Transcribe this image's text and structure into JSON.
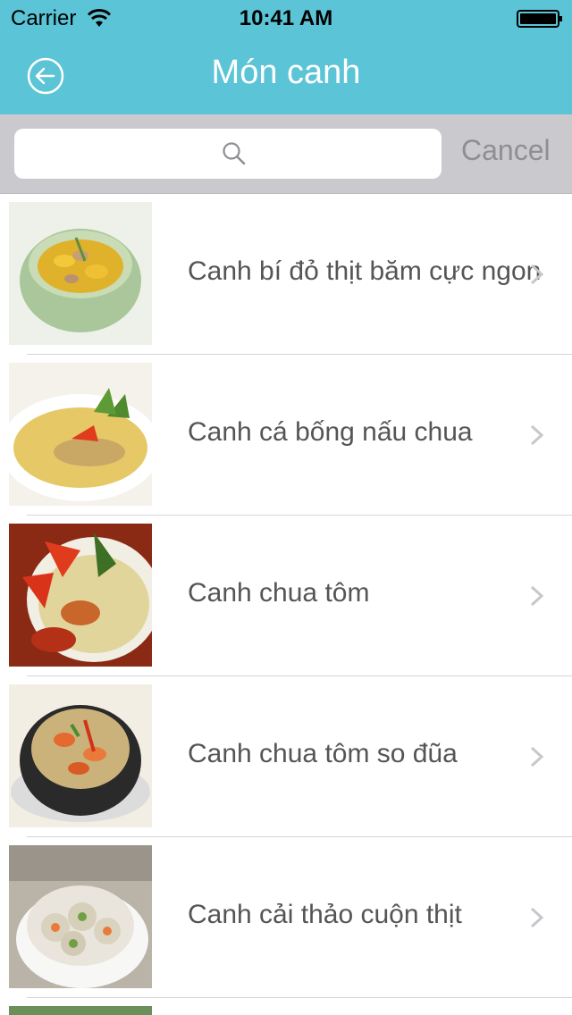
{
  "status_bar": {
    "carrier": "Carrier",
    "time": "10:41 AM"
  },
  "nav": {
    "title": "Món canh",
    "back_icon": "back-arrow-circle-icon"
  },
  "search": {
    "placeholder": "",
    "value": "",
    "cancel_label": "Cancel"
  },
  "colors": {
    "nav_background": "#5bc4d6",
    "search_background": "#c9c9ce",
    "text": "#555555"
  },
  "items": [
    {
      "label": "Canh bí đỏ thịt băm cực ngon",
      "image": "pumpkin-soup-photo"
    },
    {
      "label": "Canh cá bống nấu chua",
      "image": "fish-sour-soup-photo"
    },
    {
      "label": "Canh chua tôm",
      "image": "shrimp-sour-soup-photo"
    },
    {
      "label": "Canh chua tôm so đũa",
      "image": "shrimp-soup-claypot-photo"
    },
    {
      "label": "Canh cải thảo cuộn thịt",
      "image": "cabbage-roll-soup-photo"
    }
  ]
}
